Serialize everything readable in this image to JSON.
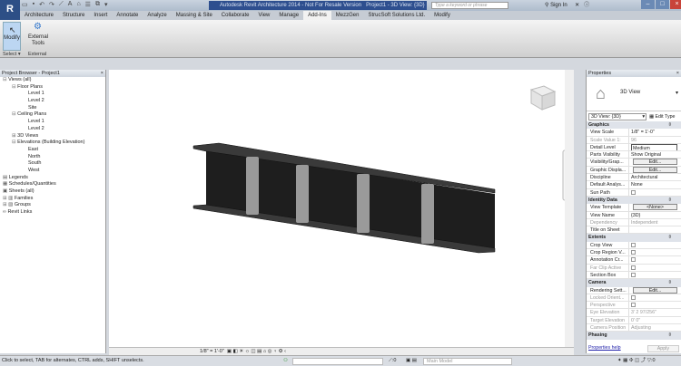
{
  "app": {
    "title": "Autodesk Revit Architecture 2014 - Not For Resale Version",
    "doc_title": "Project1 - 3D View: {3D}",
    "search_placeholder": "Type a keyword or phrase",
    "sign_in": "Sign In",
    "app_button": "R"
  },
  "tabs": [
    "Architecture",
    "Structure",
    "Insert",
    "Annotate",
    "Analyze",
    "Massing & Site",
    "Collaborate",
    "View",
    "Manage",
    "Add-Ins",
    "MezzGen",
    "StrucSoft Solutions Ltd.",
    "Modify"
  ],
  "active_tab": "Add-Ins",
  "ribbon": {
    "modify": "Modify",
    "external_tools": "External Tools",
    "select_panel": "Select",
    "external_panel": "External"
  },
  "project_browser": {
    "title": "Project Browser - Project1",
    "items": [
      {
        "label": "Views (all)",
        "level": 0,
        "toggle": "⊟"
      },
      {
        "label": "Floor Plans",
        "level": 1,
        "toggle": "⊟"
      },
      {
        "label": "Level 1",
        "level": 2
      },
      {
        "label": "Level 2",
        "level": 2
      },
      {
        "label": "Site",
        "level": 2
      },
      {
        "label": "Ceiling Plans",
        "level": 1,
        "toggle": "⊟"
      },
      {
        "label": "Level 1",
        "level": 2
      },
      {
        "label": "Level 2",
        "level": 2
      },
      {
        "label": "3D Views",
        "level": 1,
        "toggle": "⊞"
      },
      {
        "label": "Elevations (Building Elevation)",
        "level": 1,
        "toggle": "⊟"
      },
      {
        "label": "East",
        "level": 2
      },
      {
        "label": "North",
        "level": 2
      },
      {
        "label": "South",
        "level": 2
      },
      {
        "label": "West",
        "level": 2
      },
      {
        "label": "Legends",
        "level": 0,
        "icon": "▤"
      },
      {
        "label": "Schedules/Quantities",
        "level": 0,
        "icon": "▦"
      },
      {
        "label": "Sheets (all)",
        "level": 0,
        "icon": "▣"
      },
      {
        "label": "Families",
        "level": 0,
        "toggle": "⊞",
        "icon": "▥"
      },
      {
        "label": "Groups",
        "level": 0,
        "toggle": "⊞",
        "icon": "▧"
      },
      {
        "label": "Revit Links",
        "level": 0,
        "icon": "∞"
      }
    ]
  },
  "view_control": {
    "scale": "1/8\" = 1'-0\""
  },
  "properties": {
    "title": "Properties",
    "type_name": "3D View",
    "selector": "3D View: {3D}",
    "edit_type": "Edit Type",
    "sections": [
      {
        "name": "Graphics",
        "rows": [
          {
            "k": "View Scale",
            "v": "1/8\" = 1'-0\""
          },
          {
            "k": "Scale Value    1:",
            "v": "96",
            "dim": true
          },
          {
            "k": "Detail Level",
            "v": "Medium",
            "box": true
          },
          {
            "k": "Parts Visibility",
            "v": "Show Original"
          },
          {
            "k": "Visibility/Grap...",
            "v": "Edit...",
            "btn": true
          },
          {
            "k": "Graphic Displa...",
            "v": "Edit...",
            "btn": true
          },
          {
            "k": "Discipline",
            "v": "Architectural"
          },
          {
            "k": "Default Analys...",
            "v": "None"
          },
          {
            "k": "Sun Path",
            "cb": true
          }
        ]
      },
      {
        "name": "Identity Data",
        "rows": [
          {
            "k": "View Template",
            "v": "<None>",
            "btn": true
          },
          {
            "k": "View Name",
            "v": "{3D}"
          },
          {
            "k": "Dependency",
            "v": "Independent",
            "dim": true
          },
          {
            "k": "Title on Sheet",
            "v": ""
          }
        ]
      },
      {
        "name": "Extents",
        "rows": [
          {
            "k": "Crop View",
            "cb": true
          },
          {
            "k": "Crop Region V...",
            "cb": true
          },
          {
            "k": "Annotation Cr...",
            "cb": true
          },
          {
            "k": "Far Clip Active",
            "cb": true,
            "dim": true
          },
          {
            "k": "Section Box",
            "cb": true
          }
        ]
      },
      {
        "name": "Camera",
        "rows": [
          {
            "k": "Rendering Sett...",
            "v": "Edit...",
            "btn": true
          },
          {
            "k": "Locked Orient...",
            "cb": true,
            "dim": true
          },
          {
            "k": "Perspective",
            "cb": true,
            "dim": true
          },
          {
            "k": "Eye Elevation",
            "v": "3' 2 97/256\"",
            "dim": true
          },
          {
            "k": "Target Elevation",
            "v": "0' 0\"",
            "dim": true
          },
          {
            "k": "Camera Position",
            "v": "Adjusting",
            "dim": true
          }
        ]
      },
      {
        "name": "Phasing",
        "rows": []
      }
    ],
    "help": "Properties help",
    "apply": "Apply"
  },
  "status": {
    "message": "Click to select, TAB for alternates, CTRL adds, SHIFT unselects.",
    "workset_count": ":0",
    "model": "Main Model",
    "filter_count": ":0"
  },
  "colors": {
    "title_bar": "#2e4f8f",
    "beam": "#1c1c1c",
    "stiffener": "#9a9a9a"
  }
}
